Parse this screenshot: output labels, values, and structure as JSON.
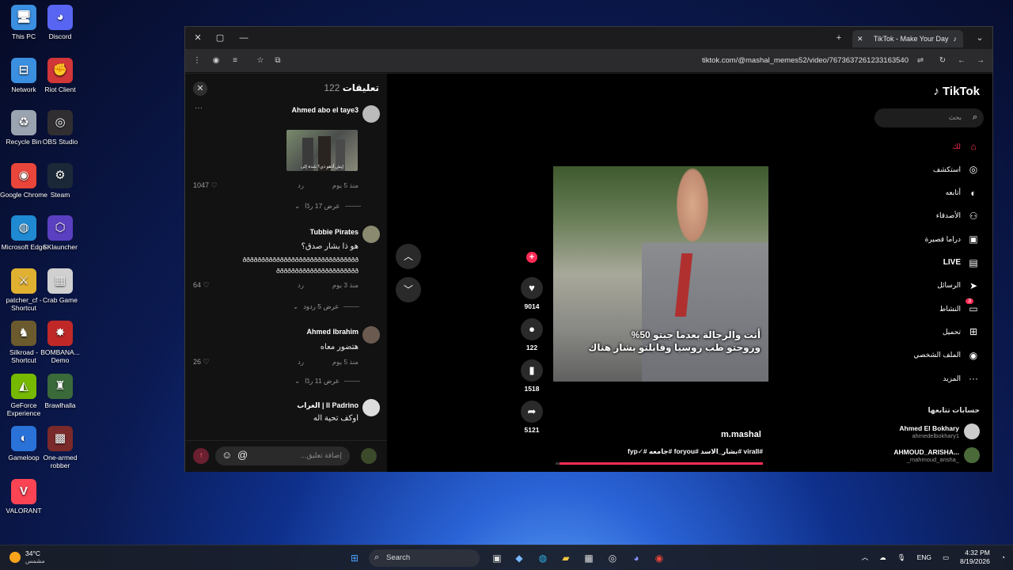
{
  "desktop": {
    "icons": [
      {
        "label": "This PC",
        "icon": "computer-icon",
        "color": "#3b8fe0"
      },
      {
        "label": "Discord",
        "icon": "discord-icon",
        "color": "#5865f2"
      },
      {
        "label": "Network",
        "icon": "network-icon",
        "color": "#3b8fe0"
      },
      {
        "label": "Riot Client",
        "icon": "riot-icon",
        "color": "#d13639"
      },
      {
        "label": "Recycle Bin",
        "icon": "recycle-bin-icon",
        "color": "#9aa3b0"
      },
      {
        "label": "OBS Studio",
        "icon": "obs-icon",
        "color": "#302e31"
      },
      {
        "label": "Google Chrome",
        "icon": "chrome-icon",
        "color": "#e9453a"
      },
      {
        "label": "Steam",
        "icon": "steam-icon",
        "color": "#1b2838"
      },
      {
        "label": "Microsoft Edge",
        "icon": "edge-icon",
        "color": "#1f8ad2"
      },
      {
        "label": "SKlauncher",
        "icon": "sklauncher-icon",
        "color": "#5a3fc0"
      },
      {
        "label": "patcher_cf - Shortcut",
        "icon": "patcher-icon",
        "color": "#e0b030"
      },
      {
        "label": "Crab Game",
        "icon": "crab-game-icon",
        "color": "#d0d0d0"
      },
      {
        "label": "Silkroad - Shortcut",
        "icon": "silkroad-icon",
        "color": "#6b5a2e"
      },
      {
        "label": "BOMBANA... Demo",
        "icon": "bombana-icon",
        "color": "#c02828"
      },
      {
        "label": "GeForce Experience",
        "icon": "geforce-icon",
        "color": "#76b900"
      },
      {
        "label": "Brawlhalla",
        "icon": "brawlhalla-icon",
        "color": "#3a6a3a"
      },
      {
        "label": "Gameloop",
        "icon": "gameloop-icon",
        "color": "#2a72d8"
      },
      {
        "label": "One-armed robber",
        "icon": "robber-icon",
        "color": "#7a2a2a"
      },
      {
        "label": "VALORANT",
        "icon": "valorant-icon",
        "color": "#fa4454"
      }
    ]
  },
  "browser": {
    "tab_title": "TikTok - Make Your Day",
    "url": "tiktok.com/@mashal_memes52/video/7673637261233163540"
  },
  "comments": {
    "title": "تعليقات",
    "count": "122",
    "input_placeholder": "إضافة تعليق...",
    "items": [
      {
        "user": "Ahmed abo el taye3",
        "text": "",
        "time": "منذ 5 يوم",
        "reply": "رد",
        "likes": "1047",
        "replies": "عرض 17 ردًا"
      },
      {
        "user": "Tubbie Pirates",
        "text": "هو ذا بشار صدق؟",
        "text2": "ððððððððððððððððððððððððððððððð",
        "text3": "ðððððððððððððððððððððð",
        "time": "منذ 3 يوم",
        "reply": "رد",
        "likes": "64",
        "replies": "عرض 5 ردود"
      },
      {
        "user": "Ahmed Ibrahim",
        "text": "هتضور معاه",
        "time": "منذ 5 يوم",
        "reply": "رد",
        "likes": "26",
        "replies": "عرض 11 ردًا"
      },
      {
        "user": "الغراب | Il Padrino",
        "text": "اوكف تحية اله"
      }
    ],
    "thumb_caption": "إيش أذهو ذي؟ شدة إلى"
  },
  "video": {
    "caption_line1": "أنت والرجالة بعدما جبتو 50%",
    "caption_line2": "وروحتو طب روسيا وقابلتو بشار هناك",
    "author": "m.mashal",
    "tags": "#virall #بشار_الاسد #foryou #جامعه #✓fyp",
    "progress": 0.98
  },
  "actions": {
    "likes": "9014",
    "comments": "122",
    "saves": "1518",
    "shares": "5121"
  },
  "sidebar": {
    "logo": "TikTok",
    "search_placeholder": "بحث",
    "nav": [
      {
        "label": "لك",
        "icon": "home-icon"
      },
      {
        "label": "استكشف",
        "icon": "compass-icon"
      },
      {
        "label": "أتابعه",
        "icon": "following-icon"
      },
      {
        "label": "الأصدقاء",
        "icon": "friends-icon"
      },
      {
        "label": "دراما قصيرة",
        "icon": "drama-icon"
      },
      {
        "label": "LIVE",
        "icon": "live-icon"
      },
      {
        "label": "الرسائل",
        "icon": "messages-icon"
      },
      {
        "label": "النشاط",
        "icon": "activity-icon",
        "badge": "3"
      },
      {
        "label": "تحميل",
        "icon": "upload-icon"
      },
      {
        "label": "الملف الشخصي",
        "icon": "profile-icon"
      },
      {
        "label": "المزيد",
        "icon": "more-icon"
      }
    ],
    "following_title": "حسابات تتابعها",
    "following": [
      {
        "name": "Ahmed El Bokhary",
        "handle": "ahmedelbokhary1"
      },
      {
        "name": "AHMOUD_ARISHA...",
        "handle": "_mahmoud_arisha_"
      }
    ]
  },
  "taskbar": {
    "temp": "34°C",
    "weather": "مشمس",
    "search_label": "Search",
    "lang": "ENG",
    "time": "4:32 PM",
    "date": "8/19/2026"
  }
}
